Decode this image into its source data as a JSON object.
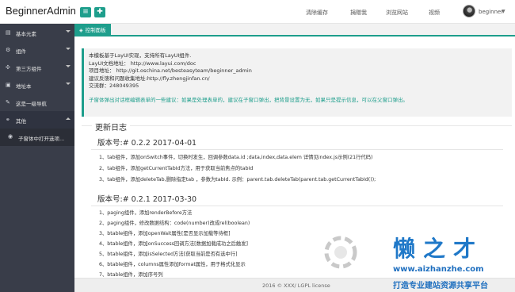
{
  "header": {
    "logo": "BeginnerAdmin",
    "btn1_icon": "menu-icon",
    "btn2_icon": "refresh-icon",
    "nav": [
      "清除缓存",
      "捐赠我",
      "浏览网站",
      "视频"
    ],
    "user": "beginner",
    "accent": "#1e9e8c"
  },
  "sidebar": {
    "items": [
      {
        "label": "基本元素",
        "icon": "layers-icon"
      },
      {
        "label": "组件",
        "icon": "gear-icon"
      },
      {
        "label": "第三方组件",
        "icon": "puzzle-icon"
      },
      {
        "label": "地址本",
        "icon": "book-icon"
      },
      {
        "label": "这是一级导航",
        "icon": "brush-icon"
      },
      {
        "label": "其他",
        "icon": "link-icon"
      }
    ],
    "sub_item": {
      "label": "子窗体中打开选项...",
      "icon": "github-icon"
    },
    "bg": "#393d49"
  },
  "tabs": [
    {
      "label": "控制面板",
      "icon": "dashboard-icon"
    }
  ],
  "notice": {
    "lines": [
      "本模板基于LayUI实现，支持所有LayUI组件.",
      "LayUI文档地址： http://www.layui.com/doc",
      "项目地址： http://git.oschina.net/besteasyteam/beginner_admin",
      "建议反馈和问题收集地址:http://fly.zhengjinfan.cn/",
      "交流群：248049395"
    ],
    "warning": "子窗体弹出对话框编辑表单的一些建议：如果是处理表单的，建议在子窗口弹出，把背景设置为无，如果只是提示信息，可以在父窗口弹出。"
  },
  "changelog": {
    "title": "更新日志",
    "versions": [
      {
        "label": "版本号:# 0.2.2 2017-04-01",
        "items": [
          "1、tab组件，添加onSwitch事件，切换时发生，回调参数data.id ;data,index,data.elem 详情见index.js示例(21行代码)",
          "2、tab组件，添加getCurrentTabId方法，用于获取当前焦点的tabId",
          "3、tab组件，添加deleteTab,删除指定tab ，参数为tabId. 示例：parent.tab.deleteTab(parent.tab.getCurrentTabId());"
        ]
      },
      {
        "label": "版本号:# 0.2.1 2017-03-30",
        "items": [
          "1、paging组件，添加renderBefore方法",
          "2、paging组件，修改数据结构：code(number)改成rel(boolean)",
          "3、btable组件，添加openWait属性[是否显示加载等待框]",
          "4、btable组件，添加onSuccess回调方法[数据加载成功之后触发]",
          "5、btable组件，添加isSelected方法[获取当前是否有选中行]",
          "6、btable组件，columns属性添加format属性，用于格式化显示",
          "7、btable组件，添加序号列"
        ]
      }
    ]
  },
  "footer": "2016 © XXX/ LGPL license",
  "watermark": {
    "title": "懒之才",
    "url": "www.aizhanzhe.com",
    "slogan": "打造专业建站资源共享平台"
  }
}
